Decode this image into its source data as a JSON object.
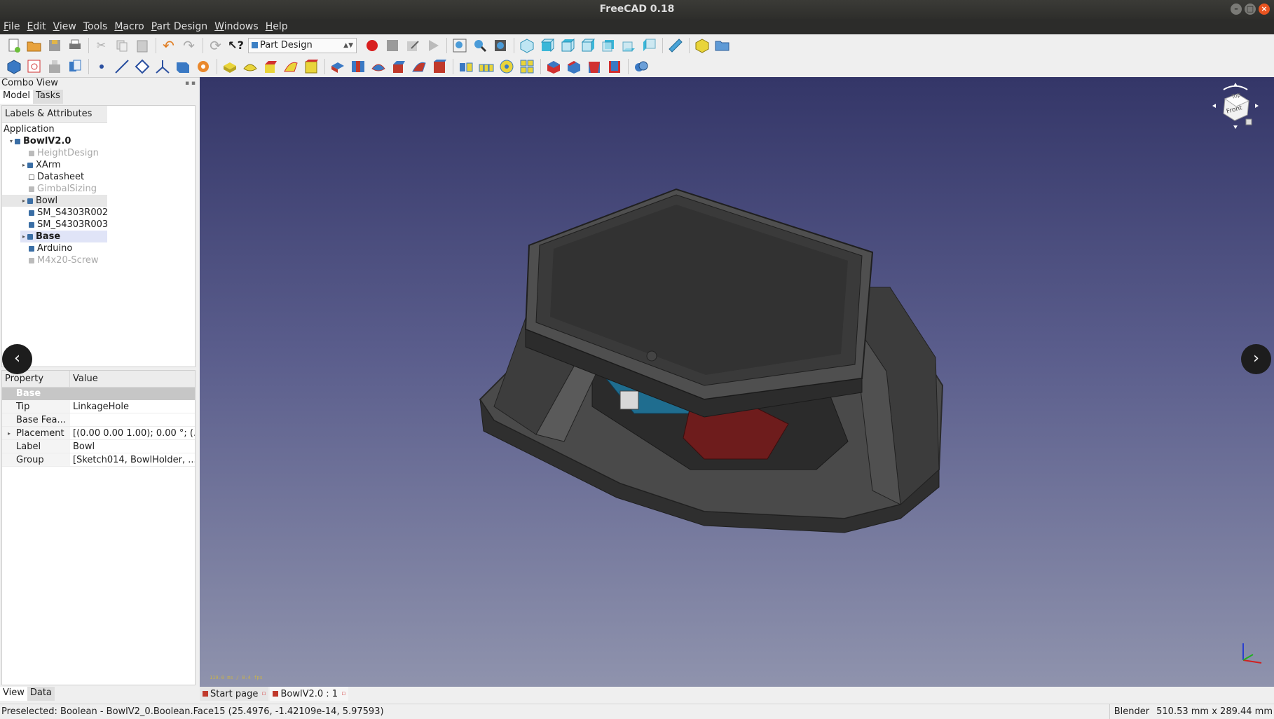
{
  "window": {
    "title": "FreeCAD 0.18",
    "controls": [
      "minimize-icon",
      "maximize-icon",
      "close-icon"
    ]
  },
  "menubar": [
    "File",
    "Edit",
    "View",
    "Tools",
    "Macro",
    "Part Design",
    "Windows",
    "Help"
  ],
  "workbench_selector": {
    "value": "Part Design"
  },
  "combo_view": {
    "title": "Combo View",
    "tabs": [
      "Model",
      "Tasks"
    ],
    "tree_header": "Labels & Attributes",
    "tree": {
      "root": "Application",
      "items": [
        {
          "label": "BowlV2.0"
        },
        {
          "label": "HeightDesign"
        },
        {
          "label": "XArm"
        },
        {
          "label": "Datasheet"
        },
        {
          "label": "GimbalSizing"
        },
        {
          "label": "Bowl"
        },
        {
          "label": "SM_S4303R002"
        },
        {
          "label": "SM_S4303R003"
        },
        {
          "label": "Base"
        },
        {
          "label": "Arduino"
        },
        {
          "label": "M4x20-Screw"
        }
      ]
    },
    "property_view": {
      "columns": [
        "Property",
        "Value"
      ],
      "group": "Base",
      "rows": [
        {
          "name": "Tip",
          "value": "LinkageHole"
        },
        {
          "name": "Base Fea...",
          "value": ""
        },
        {
          "name": "Placement",
          "value": "[(0.00 0.00 1.00); 0.00 °; (..."
        },
        {
          "name": "Label",
          "value": "Bowl"
        },
        {
          "name": "Group",
          "value": "[Sketch014, BowlHolder, ..."
        }
      ]
    },
    "bottom_tabs": [
      "View",
      "Data"
    ]
  },
  "viewport": {
    "fps_text": "119.0 ms / 8.4 fps",
    "navcube_face_labels": [
      "Top",
      "Front"
    ]
  },
  "nav_arrows": {
    "prev": "‹",
    "next": "›"
  },
  "doc_tabs": [
    "Start page",
    "BowlV2.0 : 1"
  ],
  "statusbar": {
    "preselected": "Preselected: Boolean - BowlV2_0.Boolean.Face15 (25.4976, -1.42109e-14, 5.97593)",
    "nav_style": "Blender",
    "dimensions": "510.53 mm x 289.44 mm"
  },
  "colors": {
    "viewport_top": "#343668",
    "viewport_bottom": "#8f93ad",
    "accent_red": "#c0392b",
    "selection": "#e0e4f7"
  }
}
